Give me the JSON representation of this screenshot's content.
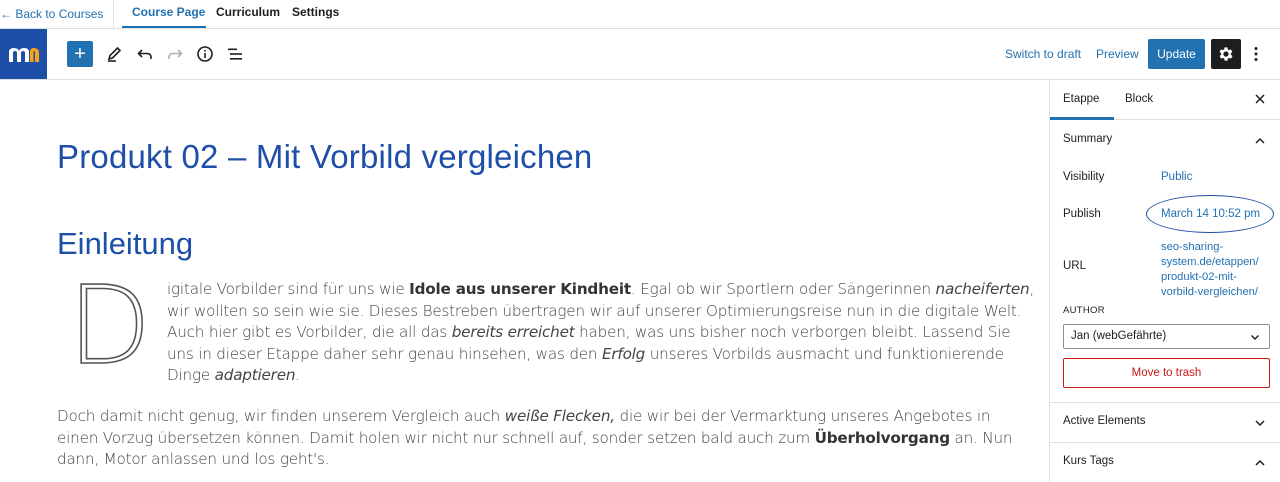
{
  "topnav": {
    "back_label": "← Back to Courses",
    "tabs": [
      {
        "label": "Course Page",
        "active": true
      },
      {
        "label": "Curriculum",
        "active": false
      },
      {
        "label": "Settings",
        "active": false
      }
    ]
  },
  "toolbar": {
    "logo_icon": "moodle-m-logo-icon",
    "add_icon": "plus-icon",
    "add_label": "+",
    "tools": [
      "pencil-icon",
      "undo-icon",
      "redo-icon",
      "info-icon",
      "list-view-icon"
    ],
    "switch_draft_label": "Switch to draft",
    "preview_label": "Preview",
    "update_label": "Update",
    "settings_icon": "gear-icon",
    "more_icon": "vertical-ellipsis-icon"
  },
  "content": {
    "title": "Produkt 02 – Mit Vorbild vergleichen",
    "heading": "Einleitung",
    "dropcap": "D",
    "para1": [
      [
        "igitale Vorbilder sind für uns wie ",
        {
          "b": "Idole aus unserer Kindheit"
        },
        ". Egal ob wir Sportlern oder Sängerinnen ",
        {
          "i": "nacheiferten"
        },
        ","
      ],
      [
        "wir wollten so sein wie sie. Dieses Bestreben übertragen wir auf unserer Optimierungsreise nun in die digitale Welt."
      ],
      [
        "Auch hier gibt es Vorbilder, die all das ",
        {
          "i": "bereits erreichet"
        },
        " haben, was uns bisher noch verborgen bleibt. Lassend Sie"
      ],
      [
        "uns in dieser Etappe daher sehr genau hinsehen, was den ",
        {
          "i": "Erfolg"
        },
        " unseres Vorbilds ausmacht und funktionierende"
      ],
      [
        "Dinge ",
        {
          "i": "adaptieren"
        },
        "."
      ]
    ],
    "para2": [
      [
        "Doch damit nicht genug, wir finden unserem Vergleich auch ",
        {
          "i": "weiße Flecken,"
        },
        " die wir bei der Vermarktung unseres Angebotes in"
      ],
      [
        "einen Vorzug übersetzen können. Damit holen wir nicht nur schnell auf, sonder setzen bald auch zum ",
        {
          "b": "Überholvorgang"
        },
        " an.  Nun"
      ],
      [
        "dann, Motor anlassen und los geht's."
      ]
    ]
  },
  "sidebar": {
    "tabs": [
      {
        "label": "Etappe",
        "active": true
      },
      {
        "label": "Block",
        "active": false
      }
    ],
    "close_icon": "close-icon",
    "summary": {
      "title": "Summary",
      "visibility_label": "Visibility",
      "visibility_value": "Public",
      "publish_label": "Publish",
      "publish_value": "March 14 10:52 pm",
      "url_label": "URL",
      "url_value": [
        "seo-sharing-",
        "system.de/etappen/",
        "produkt-02-mit-",
        "vorbild-vergleichen/"
      ],
      "author_label": "AUTHOR",
      "author_value": "Jan (webGefährte)",
      "trash_label": "Move to trash"
    },
    "panels": [
      {
        "title": "Active Elements",
        "expanded": false
      },
      {
        "title": "Kurs Tags",
        "expanded": true
      }
    ]
  },
  "colors": {
    "accent": "#2271b1",
    "title_blue": "#1e4fa8",
    "danger": "#cc1818"
  }
}
